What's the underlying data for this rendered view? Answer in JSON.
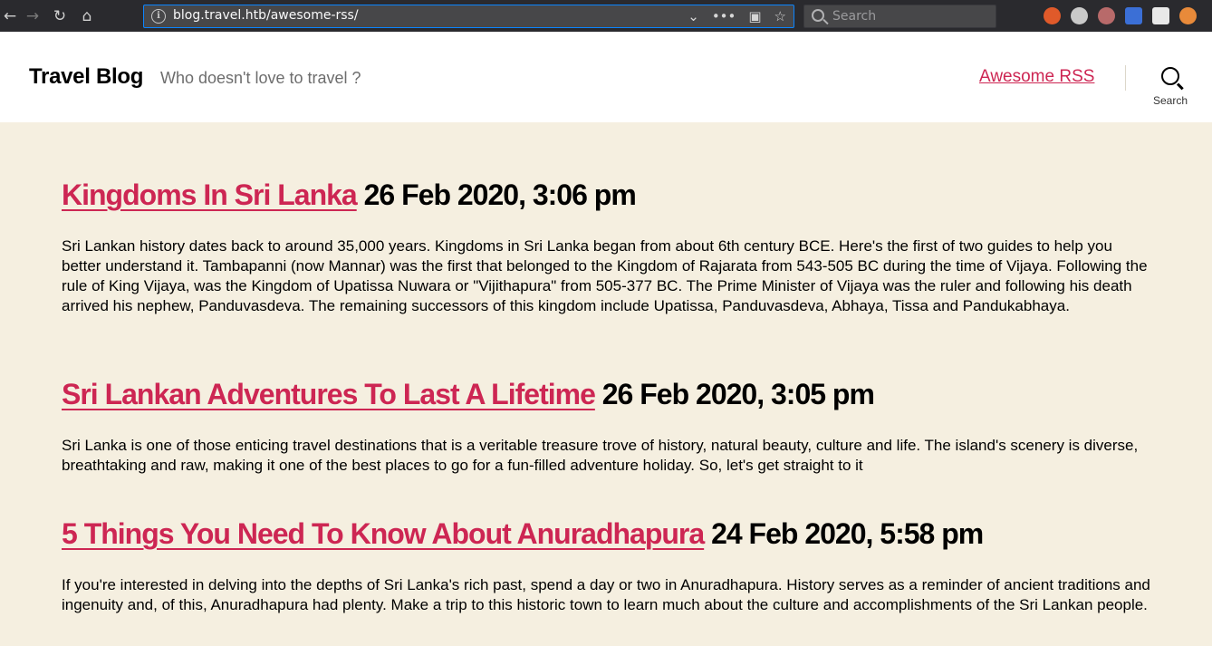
{
  "browser": {
    "url": "blog.travel.htb/awesome-rss/",
    "search_placeholder": "Search",
    "back_icon": "arrow-left-icon",
    "forward_icon": "arrow-right-icon",
    "reload_icon": "reload-icon",
    "home_icon": "home-icon"
  },
  "site": {
    "title": "Travel Blog",
    "tagline": "Who doesn't love to travel ?",
    "menu": [
      {
        "label": "Awesome RSS"
      }
    ],
    "search_label": "Search",
    "accent_color": "#cd2653",
    "background_color": "#f5efe0"
  },
  "posts": [
    {
      "title": "Kingdoms In Sri Lanka",
      "date": "26 Feb 2020, 3:06 pm",
      "excerpt": "Sri Lankan history dates back to around 35,000 years. Kingdoms in Sri Lanka began from about 6th century BCE. Here's the first of two guides to help you better understand it. Tambapanni (now Mannar) was the first that belonged to the Kingdom of Rajarata from 543-505 BC during the time of Vijaya. Following the rule of King Vijaya, was the Kingdom of Upatissa Nuwara or \"Vijithapura\" from 505-377 BC. The Prime Minister of Vijaya was the ruler and following his death arrived his nephew, Panduvasdeva. The remaining successors of this kingdom include Upatissa, Panduvasdeva, Abhaya, Tissa and Pandukabhaya."
    },
    {
      "title": "Sri Lankan Adventures To Last A Lifetime",
      "date": "26 Feb 2020, 3:05 pm",
      "excerpt": "Sri Lanka is one of those enticing travel destinations that is a veritable treasure trove of history, natural beauty, culture and life. The island's scenery is diverse, breathtaking and raw, making it one of the best places to go for a fun-filled adventure holiday. So, let's get straight to it"
    },
    {
      "title": "5 Things You Need To Know About Anuradhapura",
      "date": "24 Feb 2020, 5:58 pm",
      "excerpt": "If you're interested in delving into the depths of Sri Lanka's rich past, spend a day or two in Anuradhapura. History serves as a reminder of ancient traditions and ingenuity and, of this, Anuradhapura had plenty. Make a trip to this historic town to learn much about the culture and accomplishments of the Sri Lankan people."
    }
  ]
}
